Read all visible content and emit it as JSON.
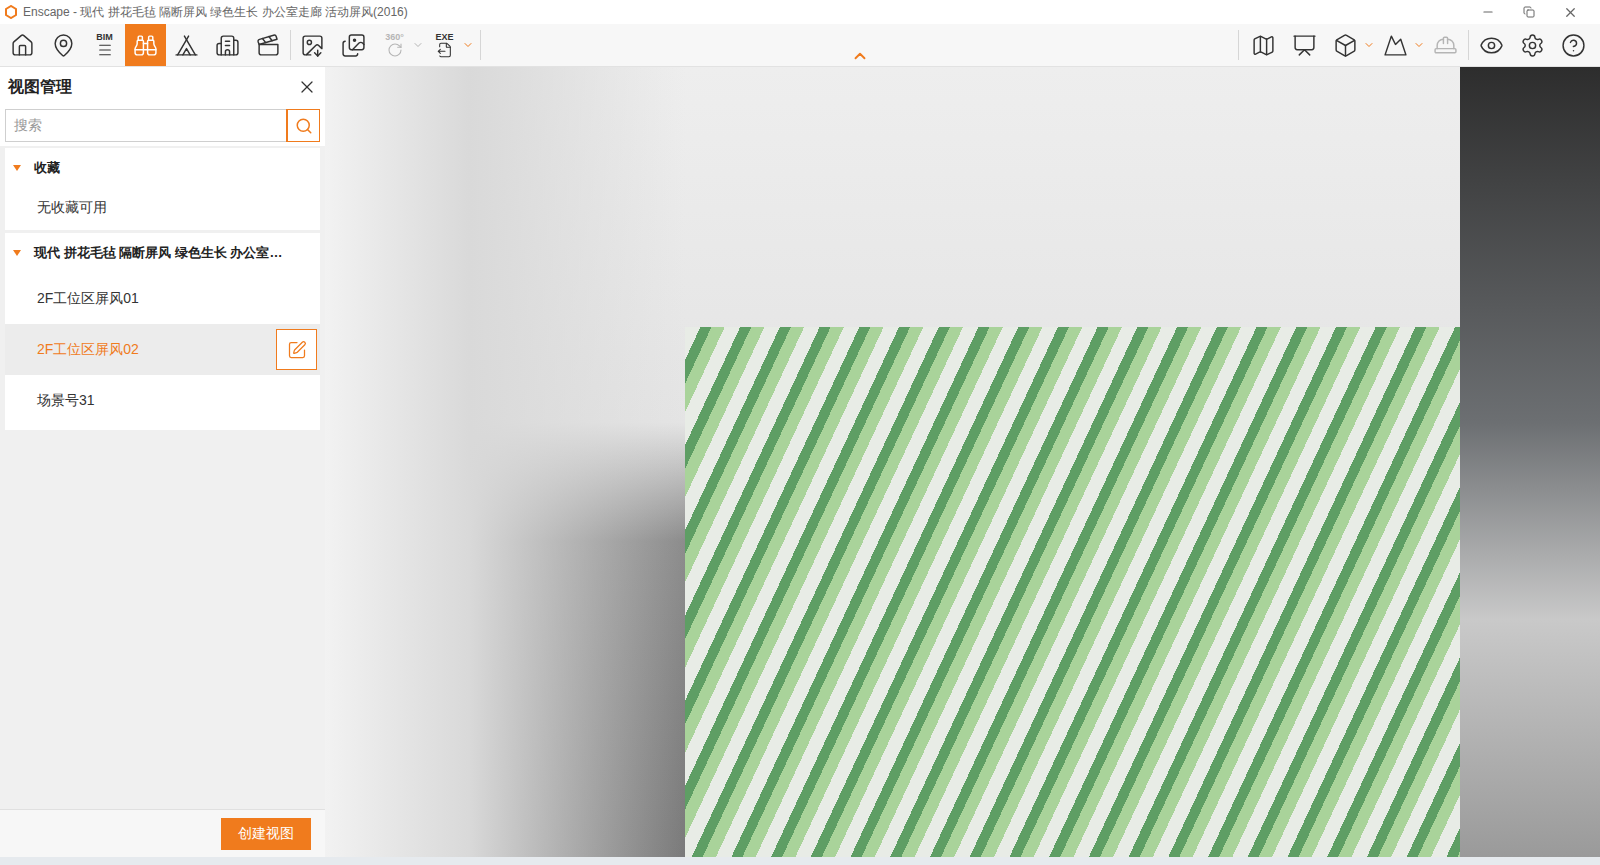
{
  "window": {
    "title": "Enscape - 现代 拼花毛毡 隔断屏风 绿色生长 办公室走廊 活动屏风(2016)"
  },
  "toolbar": {
    "left": [
      {
        "selected": false,
        "dropdown": false,
        "disabled": false
      },
      {
        "selected": false,
        "dropdown": false,
        "disabled": false
      },
      {
        "label": "BIM",
        "selected": false,
        "dropdown": false,
        "disabled": false
      },
      {
        "selected": true,
        "dropdown": false,
        "disabled": false
      },
      {
        "selected": false,
        "dropdown": false,
        "disabled": false
      },
      {
        "selected": false,
        "dropdown": false,
        "disabled": false
      },
      {
        "selected": false,
        "dropdown": false,
        "disabled": false
      },
      {
        "selected": false,
        "dropdown": false,
        "disabled": false
      },
      {
        "selected": false,
        "dropdown": false,
        "disabled": false
      },
      {
        "label": "360°",
        "selected": false,
        "dropdown": true,
        "disabled": true
      },
      {
        "label": "EXE",
        "selected": false,
        "dropdown": true,
        "disabled": false
      }
    ],
    "right": [
      {
        "selected": false,
        "dropdown": false,
        "disabled": false
      },
      {
        "selected": false,
        "dropdown": false,
        "disabled": false
      },
      {
        "selected": false,
        "dropdown": true,
        "disabled": false
      },
      {
        "selected": false,
        "dropdown": true,
        "disabled": false
      },
      {
        "selected": false,
        "dropdown": false,
        "disabled": true
      },
      {
        "selected": false,
        "dropdown": false,
        "disabled": false
      },
      {
        "selected": false,
        "dropdown": false,
        "disabled": false
      },
      {
        "selected": false,
        "dropdown": false,
        "disabled": false
      }
    ]
  },
  "panel": {
    "title": "视图管理",
    "search": {
      "placeholder": "搜索"
    },
    "groups": [
      {
        "name": "收藏",
        "expanded": true,
        "empty_text": "无收藏可用",
        "items": []
      },
      {
        "name": "现代 拼花毛毡 隔断屏风 绿色生长 办公室…",
        "expanded": true,
        "empty_text": "",
        "items": [
          {
            "label": "2F工位区屏风01",
            "selected": false
          },
          {
            "label": "2F工位区屏风02",
            "selected": true
          },
          {
            "label": "场景号31",
            "selected": false
          }
        ]
      }
    ],
    "create_button": "创建视图"
  }
}
